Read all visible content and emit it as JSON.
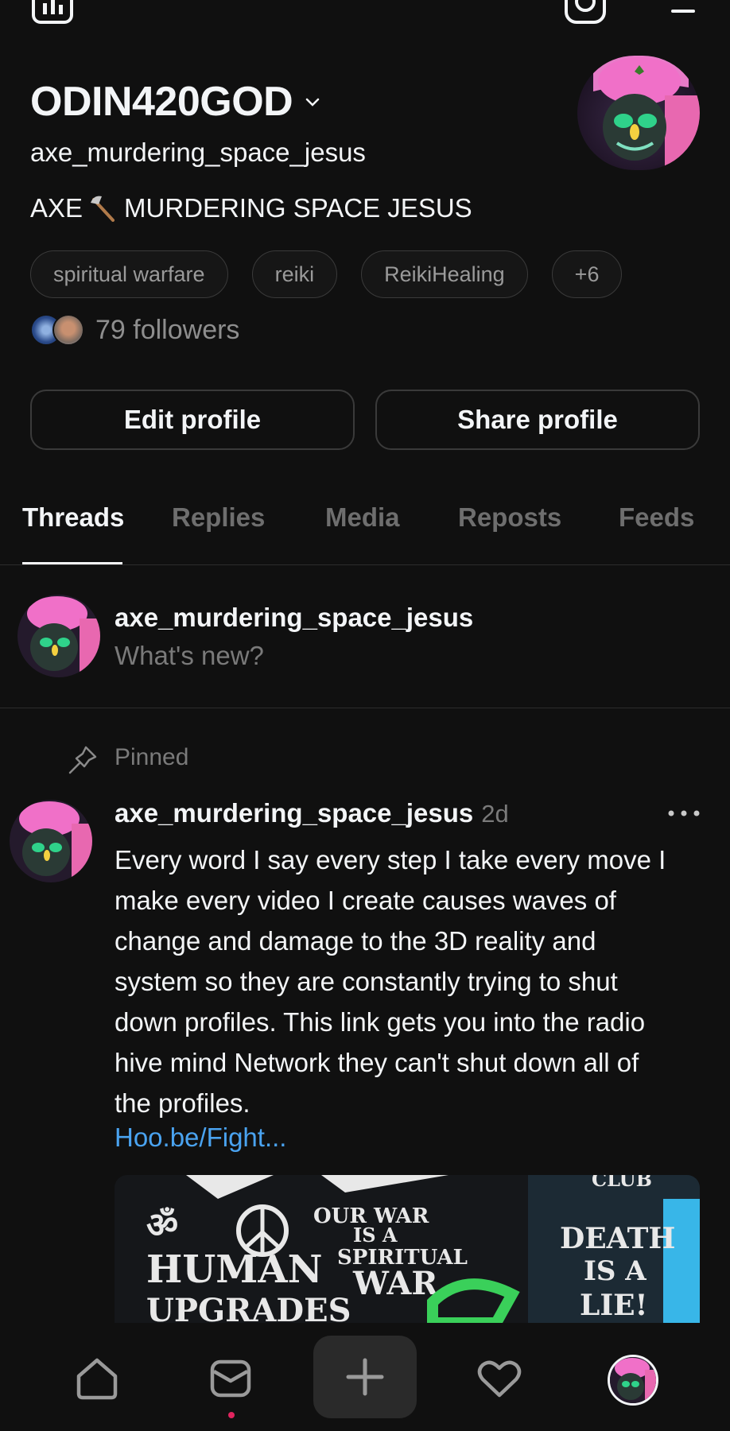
{
  "header": {
    "icons": [
      "insights-icon",
      "instagram-icon",
      "menu-icon"
    ]
  },
  "profile": {
    "display_name": "ODIN420GOD",
    "username": "axe_murdering_space_jesus",
    "bio_part1": "AXE",
    "bio_part2": "MURDERING SPACE JESUS",
    "tags": [
      "spiritual warfare",
      "reiki",
      "ReikiHealing",
      "+6"
    ],
    "followers_text": "79 followers"
  },
  "actions": {
    "edit_label": "Edit profile",
    "share_label": "Share profile"
  },
  "tabs": [
    "Threads",
    "Replies",
    "Media",
    "Reposts",
    "Feeds"
  ],
  "active_tab": "Threads",
  "composer": {
    "username": "axe_murdering_space_jesus",
    "placeholder": "What's new?"
  },
  "post": {
    "pinned_label": "Pinned",
    "username": "axe_murdering_space_jesus",
    "time": "2d",
    "lines": [
      "Every word I say every step I take every move I",
      "make every video I create causes waves of",
      "change and damage to the 3D reality and",
      "system so they are constantly trying to shut",
      "down profiles. This link gets you into the radio",
      "hive mind Network they can't shut down all of",
      "the profiles."
    ],
    "link": "Hoo.be/Fight...",
    "image_text": {
      "top": "CLUB",
      "left1": "HUMAN",
      "left2": "UPGRADES",
      "mid1": "OUR WAR",
      "mid2": "IS A",
      "mid3": "SPIRITUAL",
      "mid4": "WAR",
      "right1": "DEATH",
      "right2": "IS A",
      "right3": "LIE!"
    }
  },
  "bottom_nav": [
    "home-icon",
    "inbox-icon",
    "compose-icon",
    "activity-icon",
    "profile-avatar"
  ],
  "colors": {
    "background": "#101010",
    "text": "#f3f5f7",
    "muted": "#7a7a7a",
    "link": "#4aa3f0",
    "notification_dot": "#e0245e"
  }
}
